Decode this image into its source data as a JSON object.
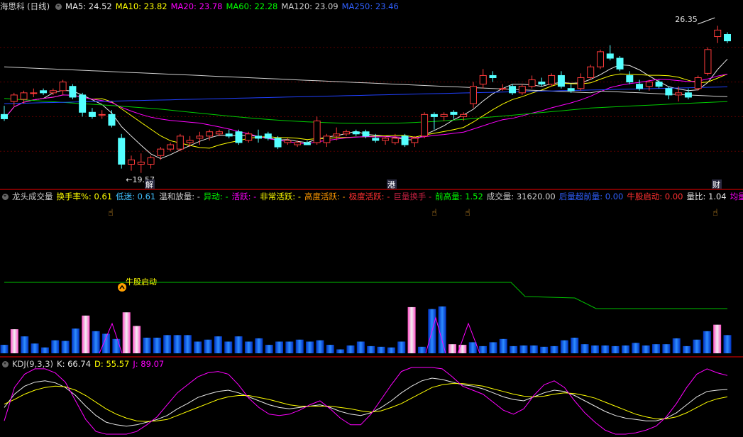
{
  "main": {
    "title": "海思科 (日线)",
    "ma": [
      {
        "label": "MA5: ",
        "value": "24.52",
        "color": "#e8e8e8"
      },
      {
        "label": "MA10: ",
        "value": "23.82",
        "color": "#ffff00"
      },
      {
        "label": "MA20: ",
        "value": "23.78",
        "color": "#ff00ff"
      },
      {
        "label": "MA60: ",
        "value": "22.28",
        "color": "#00ff00"
      },
      {
        "label": "MA120: ",
        "value": "23.09",
        "color": "#d0d0d0"
      },
      {
        "label": "MA250: ",
        "value": "23.46",
        "color": "#3060ff"
      }
    ],
    "high_label": "26.35",
    "low_label": "19.57",
    "markers": [
      {
        "text": "解",
        "x": 211
      },
      {
        "text": "港",
        "x": 552
      },
      {
        "text": "财",
        "x": 1010
      }
    ]
  },
  "vol": {
    "items": [
      {
        "label": "龙头成交量",
        "value": "",
        "color": "#d0d0d0"
      },
      {
        "label": "换手率%: ",
        "value": "0.61",
        "color": "#ffff00"
      },
      {
        "label": "低迷: ",
        "value": "0.61",
        "color": "#40c0ff"
      },
      {
        "label": "温和放量: ",
        "value": "-",
        "color": "#d0d0d0"
      },
      {
        "label": "异动: ",
        "value": "-",
        "color": "#00ff00"
      },
      {
        "label": "活跃: ",
        "value": "-",
        "color": "#ff00ff"
      },
      {
        "label": "非常活跃: ",
        "value": "-",
        "color": "#ffff00"
      },
      {
        "label": "高度活跃: ",
        "value": "-",
        "color": "#ff9900"
      },
      {
        "label": "极度活跃: ",
        "value": "-",
        "color": "#ff3030"
      },
      {
        "label": "巨量换手 ",
        "value": "-",
        "color": "#c02040"
      },
      {
        "label": "前高量: ",
        "value": "1.52",
        "color": "#00ff00"
      },
      {
        "label": "成交量: ",
        "value": "31620.00",
        "color": "#d0d0d0"
      },
      {
        "label": "后量超前量: ",
        "value": "0.00",
        "color": "#3060ff"
      },
      {
        "label": "牛股启动: ",
        "value": "0.00",
        "color": "#ff3030"
      },
      {
        "label": "量比: ",
        "value": "1.04",
        "color": "#e8e8e8"
      },
      {
        "label": "均量",
        "value": "",
        "color": "#ff00ff"
      }
    ],
    "annotation": "牛股启动"
  },
  "kdj": {
    "items": [
      {
        "label": "KDJ(9,3,3)",
        "value": "",
        "color": "#d0d0d0"
      },
      {
        "label": "K: ",
        "value": "66.74",
        "color": "#e8e8e8"
      },
      {
        "label": "D: ",
        "value": "55.57",
        "color": "#ffff00"
      },
      {
        "label": "J: ",
        "value": "89.07",
        "color": "#ff00ff"
      }
    ]
  },
  "chart_data": [
    {
      "type": "candlestick",
      "title": "海思科 (日线)",
      "ylim": [
        19.0,
        27.0
      ],
      "grid": true,
      "ohlc": [
        [
          22.3,
          22.7,
          22.0,
          22.1
        ],
        [
          22.9,
          23.3,
          22.7,
          23.2
        ],
        [
          23.0,
          23.4,
          22.8,
          23.3
        ],
        [
          23.3,
          23.5,
          23.1,
          23.3
        ],
        [
          23.4,
          23.5,
          23.2,
          23.3
        ],
        [
          23.3,
          23.5,
          23.2,
          23.4
        ],
        [
          23.4,
          23.9,
          23.2,
          23.8
        ],
        [
          23.6,
          23.7,
          23.0,
          23.1
        ],
        [
          23.2,
          23.3,
          22.2,
          22.4
        ],
        [
          22.4,
          22.6,
          22.1,
          22.2
        ],
        [
          22.3,
          22.5,
          22.1,
          22.3
        ],
        [
          22.3,
          22.5,
          21.7,
          21.8
        ],
        [
          21.2,
          21.4,
          19.8,
          20.0
        ],
        [
          20.0,
          20.4,
          19.7,
          20.2
        ],
        [
          20.0,
          20.5,
          19.6,
          20.1
        ],
        [
          20.0,
          20.4,
          19.8,
          20.3
        ],
        [
          20.4,
          20.8,
          20.2,
          20.7
        ],
        [
          20.7,
          21.0,
          20.6,
          20.9
        ],
        [
          20.7,
          21.4,
          20.6,
          21.3
        ],
        [
          21.0,
          21.3,
          20.8,
          21.1
        ],
        [
          21.2,
          21.5,
          20.9,
          21.3
        ],
        [
          21.3,
          21.6,
          21.1,
          21.5
        ],
        [
          21.4,
          21.6,
          21.3,
          21.5
        ],
        [
          21.4,
          21.6,
          21.2,
          21.3
        ],
        [
          21.5,
          21.6,
          20.9,
          21.0
        ],
        [
          21.1,
          21.5,
          21.0,
          21.4
        ],
        [
          21.3,
          21.6,
          21.0,
          21.2
        ],
        [
          21.4,
          21.5,
          21.1,
          21.2
        ],
        [
          21.2,
          21.3,
          20.7,
          20.8
        ],
        [
          21.0,
          21.2,
          20.9,
          21.1
        ],
        [
          20.9,
          21.1,
          20.8,
          21.0
        ],
        [
          21.0,
          21.1,
          20.9,
          20.9
        ],
        [
          21.0,
          22.2,
          20.9,
          22.0
        ],
        [
          21.0,
          21.4,
          20.8,
          21.3
        ],
        [
          21.3,
          21.7,
          21.1,
          21.4
        ],
        [
          21.4,
          21.6,
          21.3,
          21.5
        ],
        [
          21.5,
          21.6,
          21.3,
          21.4
        ],
        [
          21.5,
          21.6,
          21.2,
          21.3
        ],
        [
          21.2,
          21.4,
          21.0,
          21.1
        ],
        [
          21.1,
          21.3,
          20.9,
          21.2
        ],
        [
          21.0,
          21.4,
          20.9,
          21.2
        ],
        [
          21.3,
          21.4,
          20.8,
          20.9
        ],
        [
          21.0,
          21.3,
          20.8,
          21.2
        ],
        [
          21.3,
          22.4,
          21.2,
          22.3
        ],
        [
          22.3,
          22.4,
          21.6,
          22.2
        ],
        [
          22.2,
          22.4,
          22.0,
          22.3
        ],
        [
          22.4,
          22.5,
          22.1,
          22.3
        ],
        [
          22.2,
          22.4,
          22.0,
          22.3
        ],
        [
          22.8,
          23.8,
          22.6,
          23.6
        ],
        [
          23.7,
          24.4,
          23.5,
          24.1
        ],
        [
          24.1,
          24.3,
          23.8,
          24.0
        ],
        [
          23.5,
          23.7,
          23.4,
          23.5
        ],
        [
          23.6,
          23.7,
          23.2,
          23.3
        ],
        [
          23.3,
          23.7,
          23.2,
          23.6
        ],
        [
          23.6,
          24.1,
          23.5,
          23.9
        ],
        [
          23.8,
          24.0,
          23.6,
          23.7
        ],
        [
          23.7,
          24.2,
          23.6,
          24.1
        ],
        [
          24.1,
          24.3,
          23.5,
          23.6
        ],
        [
          23.5,
          23.7,
          23.3,
          23.4
        ],
        [
          23.5,
          24.2,
          23.4,
          24.0
        ],
        [
          24.0,
          24.6,
          23.9,
          24.5
        ],
        [
          24.5,
          25.3,
          24.4,
          25.2
        ],
        [
          25.1,
          25.5,
          24.8,
          24.9
        ],
        [
          24.9,
          25.0,
          24.3,
          24.4
        ],
        [
          24.1,
          24.3,
          23.7,
          23.8
        ],
        [
          23.7,
          23.9,
          23.4,
          23.5
        ],
        [
          23.6,
          23.9,
          23.4,
          23.8
        ],
        [
          23.8,
          23.9,
          23.5,
          23.6
        ],
        [
          23.5,
          23.6,
          23.0,
          23.2
        ],
        [
          23.2,
          23.6,
          22.9,
          23.3
        ],
        [
          23.3,
          23.5,
          23.0,
          23.1
        ],
        [
          23.5,
          24.1,
          23.4,
          24.0
        ],
        [
          24.2,
          25.4,
          24.1,
          25.3
        ],
        [
          25.9,
          26.4,
          25.6,
          26.2
        ],
        [
          26.0,
          26.1,
          25.6,
          25.7
        ]
      ]
    },
    {
      "type": "bar",
      "title": "龙头成交量",
      "values": [
        13,
        37,
        26,
        15,
        9,
        20,
        19,
        38,
        58,
        34,
        30,
        22,
        63,
        42,
        24,
        24,
        28,
        28,
        28,
        18,
        21,
        26,
        18,
        26,
        18,
        23,
        13,
        18,
        18,
        21,
        18,
        20,
        13,
        6,
        12,
        18,
        11,
        10,
        9,
        18,
        71,
        10,
        68,
        72,
        14,
        13,
        17,
        11,
        17,
        22,
        11,
        12,
        12,
        10,
        11,
        20,
        24,
        14,
        12,
        12,
        11,
        12,
        16,
        12,
        14,
        14,
        23,
        11,
        21,
        34,
        44,
        28
      ],
      "highlight_indices": [
        1,
        8,
        12,
        13,
        40,
        44,
        45,
        70
      ]
    },
    {
      "type": "line",
      "title": "KDJ(9,3,3)",
      "series": [
        {
          "name": "K",
          "values": [
            40,
            60,
            72,
            78,
            80,
            77,
            70,
            58,
            42,
            28,
            18,
            14,
            12,
            14,
            18,
            22,
            28,
            38,
            46,
            55,
            60,
            64,
            66,
            62,
            56,
            50,
            44,
            40,
            38,
            40,
            42,
            44,
            40,
            34,
            30,
            28,
            32,
            40,
            50,
            62,
            72,
            80,
            84,
            82,
            78,
            74,
            72,
            68,
            62,
            56,
            52,
            50,
            56,
            62,
            66,
            64,
            58,
            50,
            42,
            34,
            28,
            24,
            22,
            20,
            20,
            24,
            32,
            44,
            56,
            64,
            66,
            67
          ]
        },
        {
          "name": "D",
          "values": [
            45,
            52,
            60,
            66,
            70,
            72,
            71,
            66,
            58,
            48,
            38,
            30,
            24,
            20,
            19,
            20,
            22,
            28,
            34,
            40,
            46,
            52,
            56,
            58,
            58,
            55,
            52,
            48,
            44,
            42,
            42,
            42,
            42,
            40,
            38,
            35,
            33,
            35,
            40,
            46,
            54,
            62,
            70,
            74,
            76,
            76,
            74,
            72,
            68,
            64,
            60,
            57,
            56,
            57,
            60,
            62,
            61,
            58,
            54,
            48,
            42,
            36,
            30,
            26,
            23,
            23,
            26,
            32,
            40,
            48,
            53,
            56
          ]
        },
        {
          "name": "J",
          "values": [
            20,
            70,
            90,
            98,
            98,
            92,
            78,
            50,
            22,
            4,
            0,
            0,
            0,
            4,
            14,
            26,
            44,
            62,
            74,
            86,
            92,
            94,
            90,
            74,
            54,
            40,
            30,
            28,
            30,
            36,
            44,
            50,
            38,
            24,
            14,
            14,
            30,
            52,
            74,
            94,
            100,
            100,
            100,
            98,
            86,
            72,
            66,
            60,
            48,
            36,
            30,
            38,
            58,
            74,
            80,
            70,
            50,
            32,
            18,
            6,
            0,
            0,
            2,
            6,
            12,
            26,
            46,
            70,
            90,
            98,
            92,
            88
          ]
        }
      ]
    }
  ]
}
